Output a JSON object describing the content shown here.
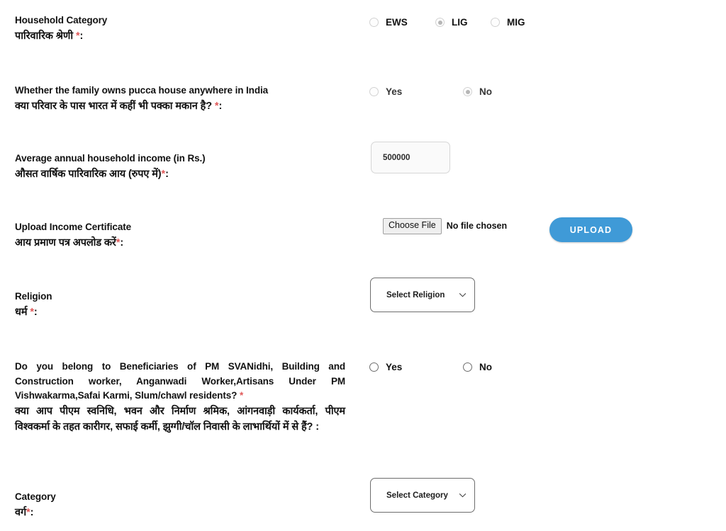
{
  "form": {
    "rows": [
      {
        "id": "household-category",
        "label_en": "Household Category",
        "label_hi": "पारिवारिक श्रेणी",
        "required_mark": "*",
        "colon": ":",
        "control": "radio",
        "options": [
          "EWS",
          "LIG",
          "MIG"
        ],
        "selected": "LIG"
      },
      {
        "id": "owns-pucca-house",
        "label_en": "Whether the family owns pucca house anywhere in India",
        "label_hi": "क्या परिवार के पास भारत में कहीं भी पक्का मकान है?",
        "required_mark": "*",
        "colon": ":",
        "control": "radio",
        "options": [
          "Yes",
          "No"
        ],
        "selected": "No"
      },
      {
        "id": "annual-income",
        "label_en": "Average annual household income (in Rs.)",
        "label_hi": "औसत वार्षिक पारिवारिक आय (रुपए में)",
        "required_mark": "*",
        "colon": ":",
        "control": "text",
        "value": "500000",
        "placeholder": ""
      },
      {
        "id": "upload-income-certificate",
        "label_en": "Upload Income Certificate",
        "label_hi": "आय प्रमाण पत्र अपलोड करें",
        "required_mark": "*",
        "colon": ":",
        "control": "file",
        "choose_file_label": "Choose File",
        "no_file_text": "No file chosen",
        "upload_button_label": "UPLOAD"
      },
      {
        "id": "religion",
        "label_en": "Religion",
        "label_hi": "धर्म",
        "required_mark": "*",
        "colon": ":",
        "control": "select",
        "selected": "Select Religion"
      },
      {
        "id": "beneficiary-scheme",
        "label_en": "Do you belong to Beneficiaries of PM SVANidhi, Building and Construction worker, Anganwadi Worker,Artisans Under PM Vishwakarma,Safai Karmi, Slum/chawl residents?",
        "label_en_line1": "Do you belong to Beneficiaries of PM SVANidhi, Building and",
        "label_en_line2": "Construction worker, Anganwadi Worker,Artisans Under PM",
        "label_en_line3": "Vishwakarma,Safai Karmi, Slum/chawl residents?",
        "label_hi": "क्या आप पीएम स्वनिधि, भवन और निर्माण श्रमिक, आंगनवाड़ी कार्यकर्ता, पीएम विश्वकर्मा के तहत कारीगर, सफाई कर्मी, झुग्गी/चॉल निवासी के लाभार्थियों में से हैं?",
        "label_hi_line1": "क्या आप पीएम स्वनिधि, भवन और निर्माण श्रमिक, आंगनवाड़ी कार्यकर्ता, पीएम",
        "label_hi_line2": "विश्वकर्मा के तहत कारीगर, सफाई कर्मी, झुग्गी/चॉल निवासी के लाभार्थियों में से हैं?",
        "required_mark": "*",
        "colon": ":",
        "control": "radio",
        "options": [
          "Yes",
          "No"
        ],
        "selected": ""
      },
      {
        "id": "category",
        "label_en": "Category",
        "label_hi": "वर्ग",
        "required_mark": "*",
        "colon": ":",
        "control": "select",
        "selected": "Select Category"
      }
    ]
  },
  "colors": {
    "accent_blue": "#3f9ad7",
    "required_red": "#e05a5a",
    "text": "#111111",
    "select_border": "#6d6d6d",
    "input_bg": "#fafafa"
  }
}
